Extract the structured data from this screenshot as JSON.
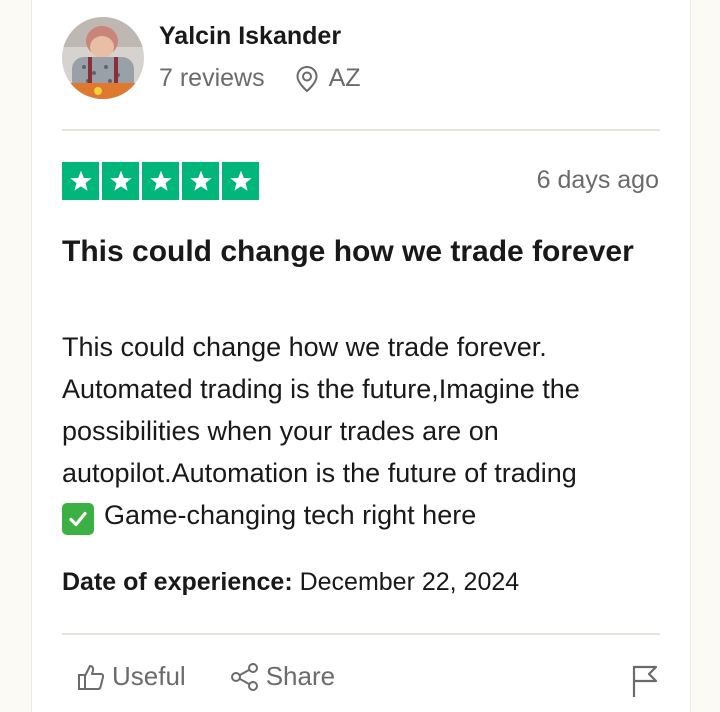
{
  "reviewer": {
    "name": "Yalcin Iskander",
    "reviews": "7 reviews",
    "location": "AZ"
  },
  "review": {
    "rating": 5,
    "rating_max": 5,
    "date_ago": "6 days ago",
    "title": "This could change how we trade forever",
    "body_line1": "This could change how we trade forever.",
    "body_line2": "Automated trading is the future,Imagine the",
    "body_line3": "possibilities when your trades are on",
    "body_line4": "autopilot.Automation is the future of trading",
    "body_line5": "Game-changing tech right here",
    "experience_label": "Date of experience:",
    "experience_date": "December 22, 2024"
  },
  "actions": {
    "useful": "Useful",
    "share": "Share"
  },
  "icons": {
    "location": "location-pin-icon",
    "check": "check-mark-emoji-icon",
    "useful": "thumbs-up-icon",
    "share": "share-icon",
    "report": "flag-icon"
  },
  "colors": {
    "star_green": "#00b67a",
    "check_green": "#3cb043",
    "muted_text": "#6b6b6b"
  }
}
